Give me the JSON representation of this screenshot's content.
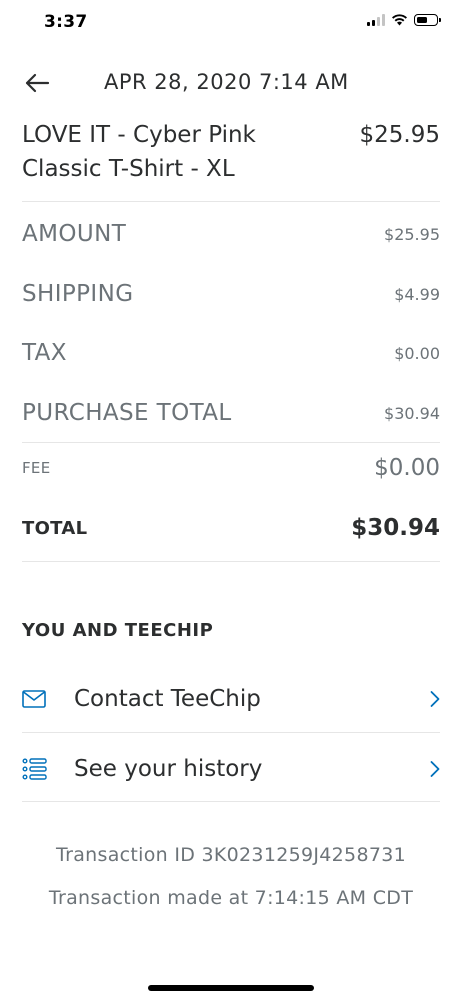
{
  "status_bar": {
    "time": "3:37",
    "signal_bars_active": 2,
    "signal_bars_total": 4,
    "battery_level": 0.6
  },
  "header": {
    "date": "APR 28, 2020  7:14 AM"
  },
  "product": {
    "name": "LOVE IT - Cyber Pink Classic T-Shirt - XL",
    "price": "$25.95"
  },
  "breakdown": {
    "amount_label": "AMOUNT",
    "amount_value": "$25.95",
    "shipping_label": "SHIPPING",
    "shipping_value": "$4.99",
    "tax_label": "TAX",
    "tax_value": "$0.00",
    "purchase_total_label": "PURCHASE TOTAL",
    "purchase_total_value": "$30.94",
    "fee_label": "FEE",
    "fee_value": "$0.00",
    "total_label": "TOTAL",
    "total_value": "$30.94"
  },
  "section": {
    "title": "YOU AND TEECHIP",
    "links": [
      {
        "label": "Contact TeeChip",
        "icon": "envelope-icon"
      },
      {
        "label": "See your history",
        "icon": "list-icon"
      }
    ]
  },
  "footer": {
    "transaction_id": "Transaction ID 3K0231259J4258731",
    "transaction_time": "Transaction made at 7:14:15 AM CDT"
  },
  "colors": {
    "accent": "#0070ba",
    "text_primary": "#2c2e2f",
    "text_secondary": "#6c7378",
    "divider": "#e6e6e6"
  }
}
